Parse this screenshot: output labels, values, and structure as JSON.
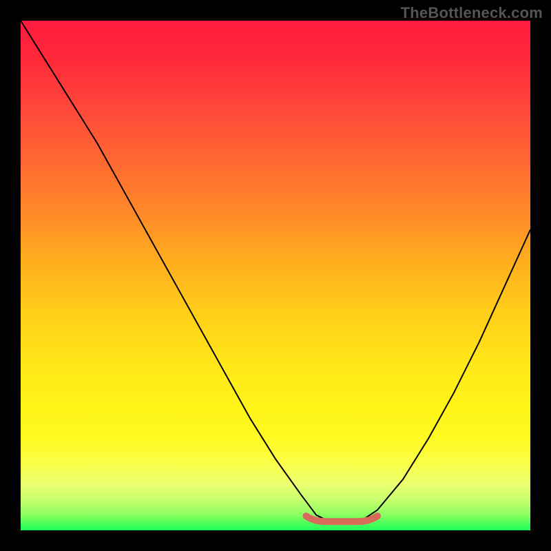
{
  "watermark": "TheBottleneck.com",
  "chart_data": {
    "type": "line",
    "title": "",
    "xlabel": "",
    "ylabel": "",
    "xlim": [
      0,
      1
    ],
    "ylim": [
      0,
      1
    ],
    "grid": false,
    "legend": false,
    "series": [
      {
        "name": "curve",
        "x": [
          0.0,
          0.05,
          0.1,
          0.15,
          0.2,
          0.25,
          0.3,
          0.35,
          0.4,
          0.45,
          0.5,
          0.55,
          0.58,
          0.6,
          0.63,
          0.67,
          0.7,
          0.75,
          0.8,
          0.85,
          0.9,
          0.95,
          1.0
        ],
        "y": [
          1.0,
          0.92,
          0.84,
          0.76,
          0.67,
          0.58,
          0.49,
          0.4,
          0.31,
          0.22,
          0.14,
          0.07,
          0.03,
          0.02,
          0.02,
          0.02,
          0.04,
          0.1,
          0.18,
          0.27,
          0.37,
          0.48,
          0.59
        ]
      }
    ],
    "accent_segment": {
      "description": "short salmon highlight along the curve minimum",
      "x_start": 0.56,
      "x_end": 0.7,
      "y": 0.02,
      "color": "#d86a5a"
    },
    "background_gradient": {
      "stops": [
        {
          "pos": 0.0,
          "color": "#ff1a3d"
        },
        {
          "pos": 0.5,
          "color": "#ffd018"
        },
        {
          "pos": 0.85,
          "color": "#fbff4a"
        },
        {
          "pos": 1.0,
          "color": "#1aff58"
        }
      ],
      "direction": "top-to-bottom"
    }
  }
}
